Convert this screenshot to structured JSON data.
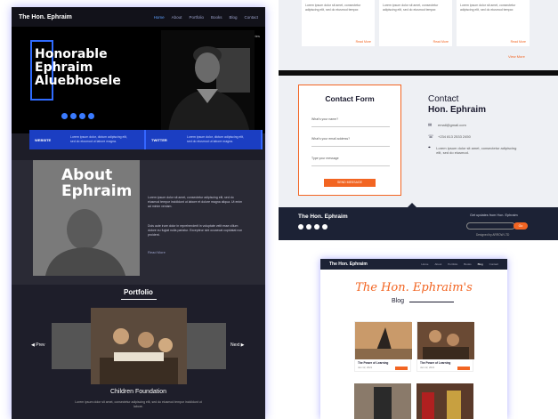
{
  "left": {
    "nav": {
      "brand": "The Hon. Ephraim",
      "links": [
        {
          "label": "Home",
          "active": true
        },
        {
          "label": "About",
          "active": false
        },
        {
          "label": "Portfolio",
          "active": false
        },
        {
          "label": "Books",
          "active": false
        },
        {
          "label": "Blog",
          "active": false
        },
        {
          "label": "Contact",
          "active": false
        }
      ]
    },
    "hero": {
      "login": "Hon Login Stories",
      "line1": "Honorable",
      "line2": "Ephraim",
      "line3": "Aluebhosele"
    },
    "infobar": [
      {
        "label": "WEBSITE",
        "text": "Lorem ipsum dolor, dictum adipiscing elit, sed do eiusmod ut labore magna."
      },
      {
        "label": "TWITTER",
        "text": "Lorem ipsum dolor, dictum adipiscing elit, sed do eiusmod ut labore magna."
      }
    ],
    "about": {
      "line1": "About",
      "line2": "Ephraim",
      "para1": "Lorem ipsum dolor sit amet, consectetur adipiscing elit, sed do eiusmod tempor incididunt ut labore et dolore magna aliqua. Ut enim ad minim veniam.",
      "para2": "Duis aute irure dolor in reprehenderit in voluptate velit esse cillum dolore eu fugiat nulla pariatur. Excepteur sint occaecat cupidatat non proident.",
      "more": "Read More"
    },
    "portfolio": {
      "heading": "Portfolio",
      "prev": "Prev",
      "next": "Next",
      "caption": "Children Foundation",
      "desc": "Lorem ipsum dolor sit amet, consectetur adipiscing elit, sed do eiusmod tempor incididunt ut labore."
    }
  },
  "right_top": {
    "cards": [
      {
        "text": "Lorem ipsum dolor sit amet, consectetur adipiscing elit, sed do eiusmod tempor.",
        "more": "Read More"
      },
      {
        "text": "Lorem ipsum dolor sit amet, consectetur adipiscing elit, sed do eiusmod tempor.",
        "more": "Read More"
      },
      {
        "text": "Lorem ipsum dolor sit amet, consectetur adipiscing elit, sed do eiusmod tempor.",
        "more": "Read More"
      }
    ],
    "view_more": "View More",
    "contact_form": {
      "heading": "Contact Form",
      "name_placeholder": "What's your name?",
      "email_placeholder": "What's your email address?",
      "message_placeholder": "Type your message",
      "submit": "SEND MESSAGE"
    },
    "contact": {
      "heading1": "Contact",
      "heading2": "Hon. Ephraim",
      "email": "email@gmail.com",
      "phone": "+234 813 2533 2450",
      "address": "Lorem ipsum dolor sit amet, consectetur adipiscing elit, sed do eiusmod."
    },
    "footer": {
      "brand": "The Hon. Ephraim",
      "subscribe_title": "Get updates from Hon. Ephraim",
      "subscribe_btn": "Go",
      "credit": "Designed by ARROW LTD"
    }
  },
  "right_bottom": {
    "nav": {
      "brand": "The Hon. Ephraim",
      "links": [
        {
          "label": "Home",
          "active": false
        },
        {
          "label": "About",
          "active": false
        },
        {
          "label": "Portfolio",
          "active": false
        },
        {
          "label": "Books",
          "active": false
        },
        {
          "label": "Blog",
          "active": true
        },
        {
          "label": "Contact",
          "active": false
        }
      ]
    },
    "title": "The Hon. Ephraim's",
    "subtitle": "Blog",
    "posts": [
      {
        "title": "The Power of Learning",
        "date": "Jan 12, 2021"
      },
      {
        "title": "The Power of Learning",
        "date": "Jan 12, 2021"
      }
    ]
  }
}
